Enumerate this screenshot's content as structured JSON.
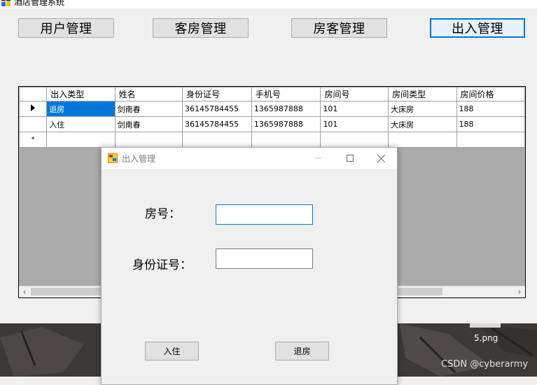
{
  "window": {
    "title": "酒店管理系统"
  },
  "nav": {
    "buttons": [
      "用户管理",
      "客房管理",
      "房客管理",
      "出入管理"
    ]
  },
  "grid": {
    "columns": [
      "出入类型",
      "姓名",
      "身份证号",
      "手机号",
      "房间号",
      "房间类型",
      "房间价格"
    ],
    "rows": [
      [
        "退房",
        "剑南春",
        "36145784455",
        "1365987888",
        "101",
        "大床房",
        "188"
      ],
      [
        "入住",
        "剑南春",
        "36145784455",
        "1365987888",
        "101",
        "大床房",
        "188"
      ]
    ],
    "new_row_marker": "*"
  },
  "dialog": {
    "title": "出入管理",
    "room_label": "房号：",
    "id_label": "身份证号：",
    "room_value": "",
    "id_value": "",
    "checkin_button": "入住",
    "checkout_button": "退房"
  },
  "desktop": {
    "file_label": "5.png",
    "watermark": "CSDN @cyberarmy"
  },
  "colors": {
    "selection": "#0078d7",
    "grid_background": "#ababab"
  }
}
